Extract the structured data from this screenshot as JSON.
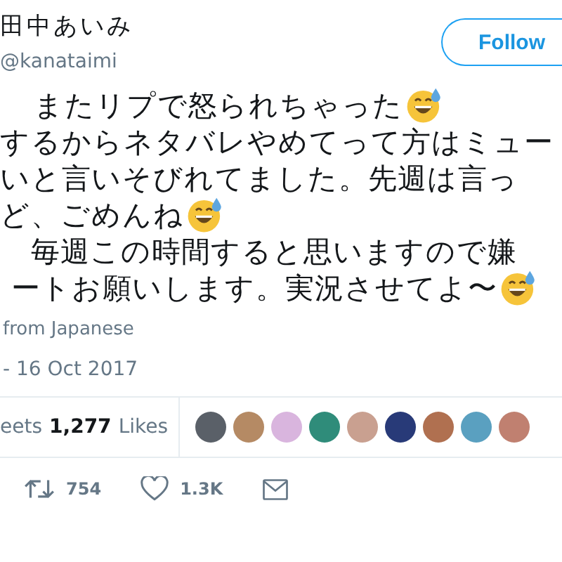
{
  "author": {
    "name": "田中あいみ",
    "handle": "@kanataimi"
  },
  "follow_button": {
    "label": "Follow"
  },
  "tweet_lines": [
    {
      "text": "またリプで怒られちゃった",
      "emoji": true
    },
    {
      "text": "するからネタバレやめてって方はミュー",
      "emoji": false
    },
    {
      "text": "いと言いそびれてました。先週は言っ",
      "emoji": false
    },
    {
      "text": "ど、ごめんね",
      "emoji": true
    },
    {
      "text": "毎週この時間すると思いますので嫌",
      "emoji": false
    },
    {
      "text": "ートお願いします。実況させてよ〜",
      "emoji": true
    }
  ],
  "translated": "from Japanese",
  "timestamp": "- 16 Oct 2017",
  "stats": {
    "retweets_label": "eets",
    "likes_count": "1,277",
    "likes_label": "Likes"
  },
  "actions": {
    "retweets": "754",
    "likes": "1.3K"
  }
}
